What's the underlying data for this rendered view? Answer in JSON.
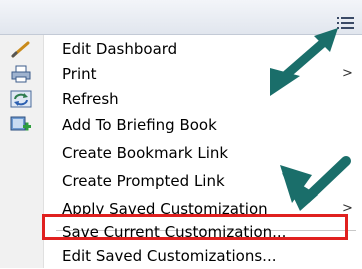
{
  "toolbar": {
    "menu_icon": "menu-lines-icon"
  },
  "menu": {
    "items": [
      {
        "label": "Edit Dashboard",
        "icon": "pencil-icon"
      },
      {
        "label": "Print",
        "icon": "printer-icon",
        "submenu": true
      },
      {
        "label": "Refresh",
        "icon": "refresh-icon"
      },
      {
        "label": "Add To Briefing Book",
        "icon": "add-briefing-book-icon"
      },
      {
        "label": "Create Bookmark Link"
      },
      {
        "label": "Create Prompted Link"
      },
      {
        "label": "Apply Saved Customization",
        "submenu": true
      },
      {
        "label": "Save Current Customization..."
      },
      {
        "label": "Edit Saved Customizations..."
      }
    ]
  },
  "annotations": {
    "highlight_color": "#e0201f",
    "arrow_color": "#1a6e6a"
  },
  "submenu_glyph": ">"
}
